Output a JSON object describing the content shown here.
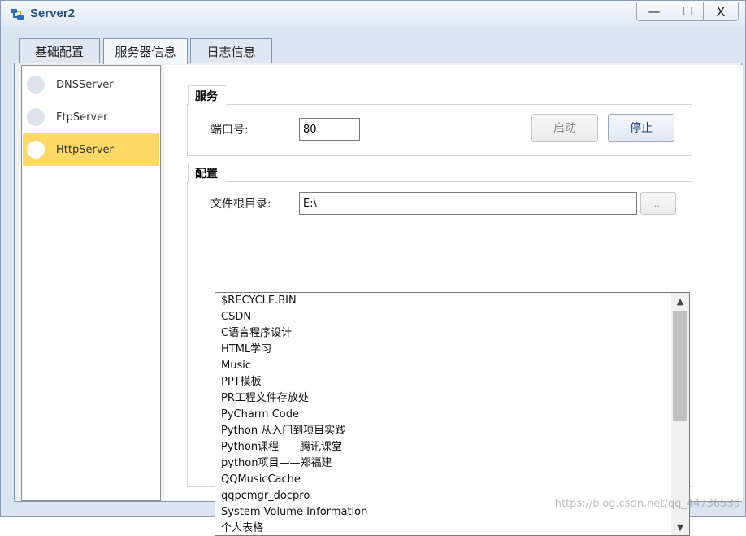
{
  "window": {
    "title": "Server2"
  },
  "titlebar_buttons": {
    "minimize": "—",
    "maximize": "☐",
    "close": "X"
  },
  "tabs": [
    {
      "label": "基础配置",
      "active": false
    },
    {
      "label": "服务器信息",
      "active": true
    },
    {
      "label": "日志信息",
      "active": false
    }
  ],
  "server_list": [
    {
      "label": "DNSServer",
      "selected": false
    },
    {
      "label": "FtpServer",
      "selected": false
    },
    {
      "label": "HttpServer",
      "selected": true
    }
  ],
  "service_group": {
    "title": "服务",
    "port_label": "端口号:",
    "port_value": "80",
    "start_button": "启动",
    "stop_button": "停止"
  },
  "config_group": {
    "title": "配置",
    "root_label": "文件根目录:",
    "root_value": "E:\\",
    "browse_button": "..."
  },
  "files": [
    "$RECYCLE.BIN",
    "CSDN",
    "C语言程序设计",
    "HTML学习",
    "Music",
    "PPT模板",
    "PR工程文件存放处",
    "PyCharm Code",
    "Python 从入门到项目实践",
    "Python课程——腾讯课堂",
    "python项目——郑福建",
    "QQMusicCache",
    "qqpcmgr_docpro",
    "System Volume Information",
    "个人表格"
  ],
  "watermark": "https://blog.csdn.net/qq_44736539",
  "colors": {
    "selected_item": "#ffd966",
    "title_text": "#2a4d7a"
  }
}
